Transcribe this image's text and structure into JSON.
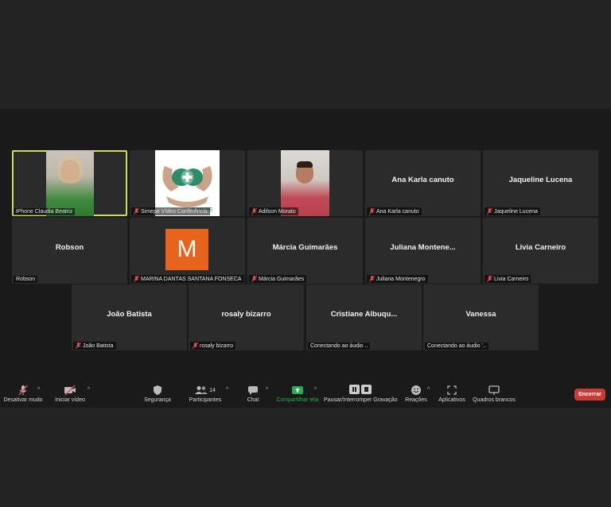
{
  "participants": [
    {
      "display": "",
      "label": "iPhone Claudia Beatriz",
      "muted": false
    },
    {
      "display": "",
      "label": "Simepe Vídeo Conferência",
      "muted": true,
      "logo_text": "SIMEPE"
    },
    {
      "display": "",
      "label": "Adilson Morato",
      "muted": true
    },
    {
      "display": "Ana Karla canuto",
      "label": "Ana Karla canuto",
      "muted": true
    },
    {
      "display": "Jaqueline Lucena",
      "label": "Jaqueline Lucena",
      "muted": true
    },
    {
      "display": "Robson",
      "label": "Robson",
      "muted": false
    },
    {
      "display": "",
      "label": "MARINA DANTAS SANTANA FONSECA",
      "muted": true,
      "avatar_letter": "M"
    },
    {
      "display": "Márcia Guimarães",
      "label": "Márcia Guimarães",
      "muted": true
    },
    {
      "display": "Juliana  Montene...",
      "label": "Juliana Montenegro",
      "muted": true
    },
    {
      "display": "Livia Carneiro",
      "label": "Livia Carneiro",
      "muted": true
    },
    {
      "display": "João Batista",
      "label": "João Batista",
      "muted": true
    },
    {
      "display": "rosaly bizarro",
      "label": "rosaly bizarro",
      "muted": true
    },
    {
      "display": "Cristiane  Albuqu...",
      "label": "Conectando ao áudio ..",
      "muted": false
    },
    {
      "display": "Vanessa",
      "label": "Conectando ao áudio '..",
      "muted": false
    }
  ],
  "toolbar": {
    "mute": "Desativar mudo",
    "video": "Iniciar vídeo",
    "security": "Segurança",
    "participants": "Participantes",
    "participants_count": "14",
    "chat": "Chat",
    "share": "Compartilhar tela",
    "record": "Pausar/Interromper Gravação",
    "reactions": "Reações",
    "apps": "Aplicativos",
    "whiteboards": "Quadros brancos",
    "end": "Encerrar"
  },
  "colors": {
    "active_speaker": "#cddc5a",
    "share_green": "#22b14c",
    "end_red": "#c83a36",
    "avatar_orange": "#e8631c"
  }
}
